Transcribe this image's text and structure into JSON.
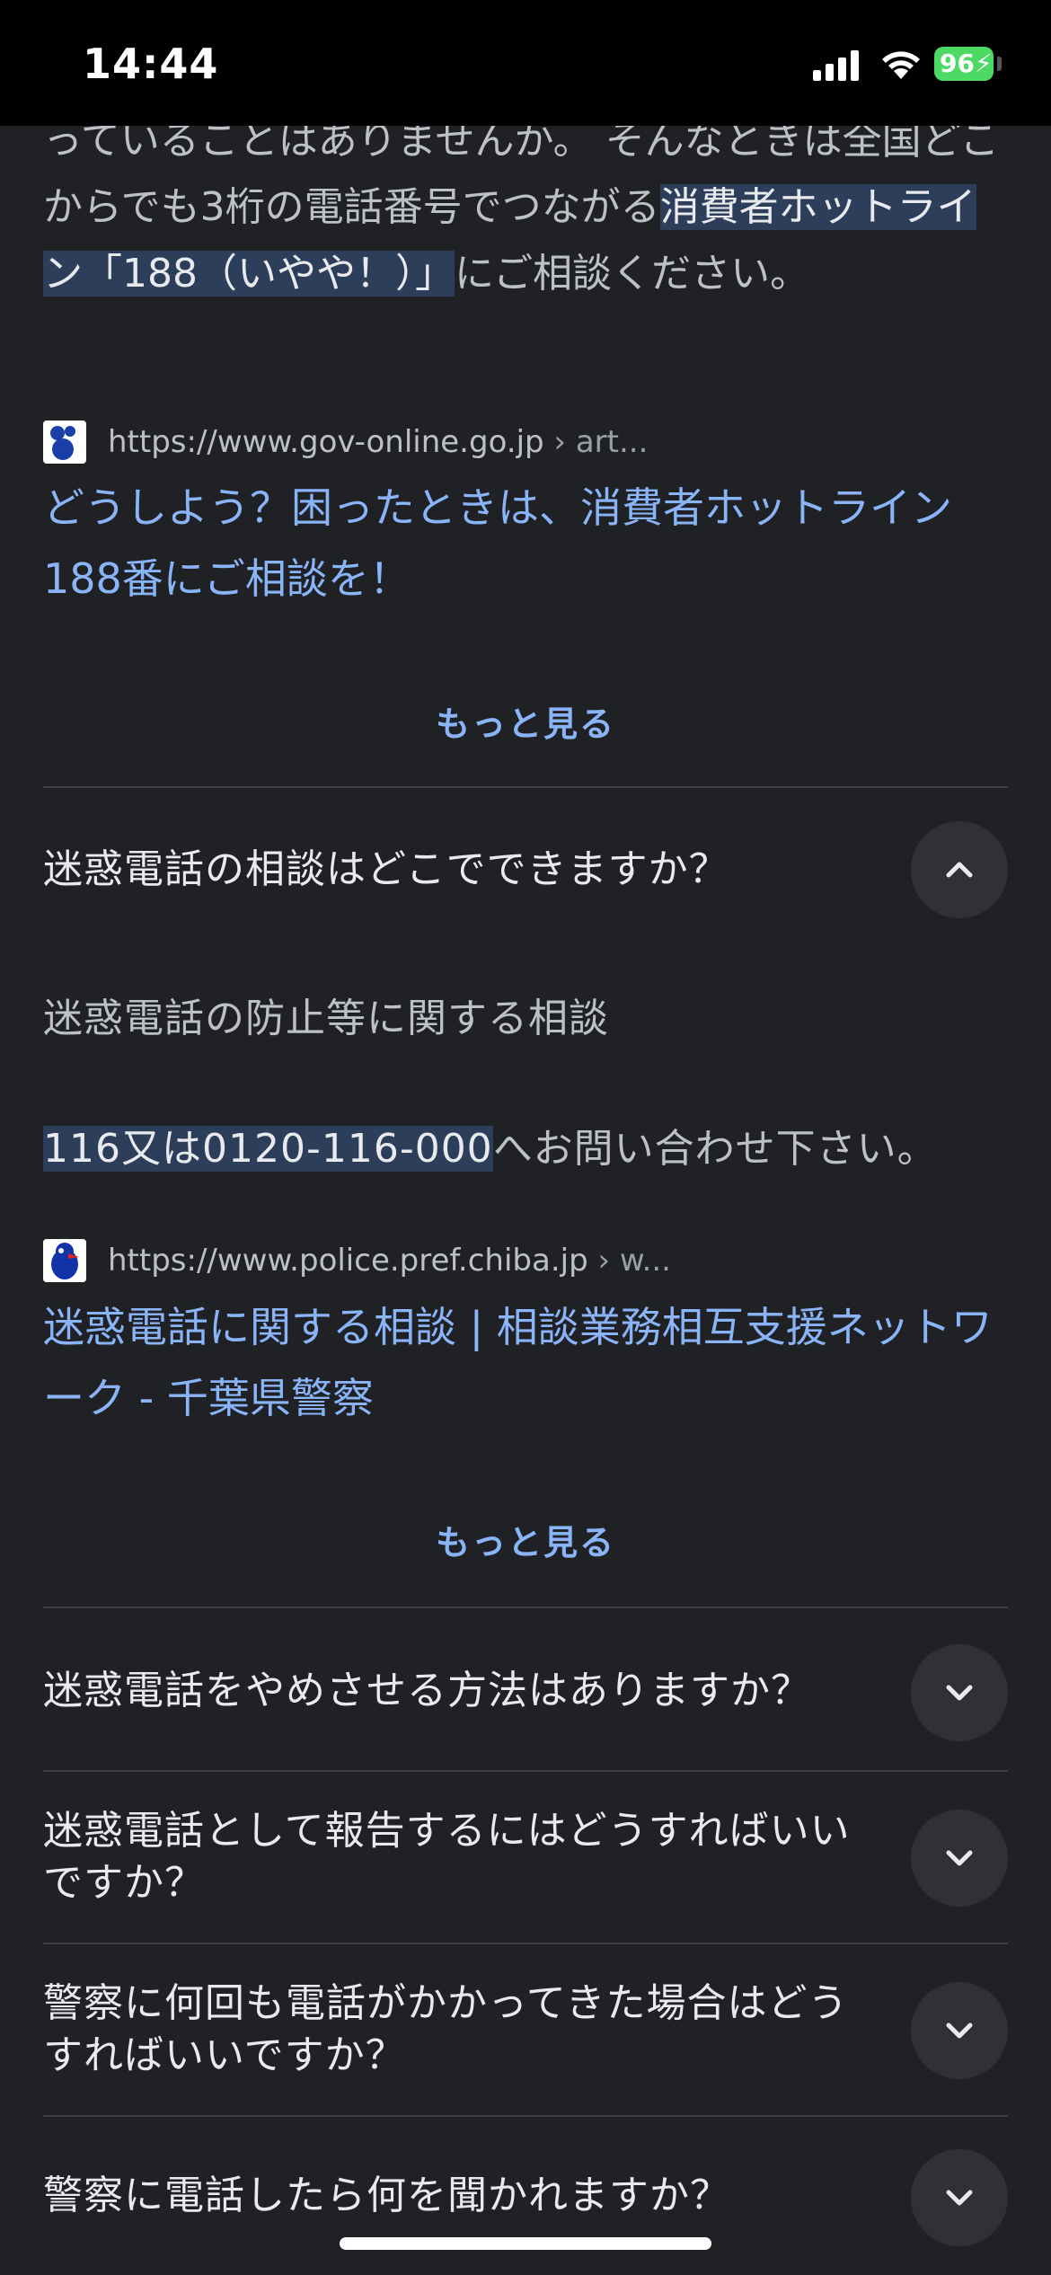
{
  "status_bar": {
    "time": "14:44",
    "battery": "96"
  },
  "snippet1": {
    "pre": "っていることはありませんか。 そんなときは全国どこからでも3桁の電話番号でつながる",
    "highlight": "消費者ホットライン「188（いやや！）」",
    "post": "にご相談ください。"
  },
  "result1": {
    "url": "https://www.gov-online.go.jp",
    "crumb": " › art...",
    "title": "どうしよう？困ったときは、消費者ホットライン188番にご相談を！",
    "more": "もっと見る"
  },
  "faq": [
    {
      "question": "迷惑電話の相談はどこでできますか？",
      "expanded": true
    },
    {
      "question": "迷惑電話をやめさせる方法はありますか？",
      "expanded": false
    },
    {
      "question": "迷惑電話として報告するにはどうすればいいですか？",
      "expanded": false
    },
    {
      "question": "警察に何回も電話がかかってきた場合はどうすればいいですか？",
      "expanded": false
    },
    {
      "question": "警察に電話したら何を聞かれますか？",
      "expanded": false
    }
  ],
  "answer1": {
    "line1": "迷惑電話の防止等に関する相談",
    "highlight": "116又は0120-116-000",
    "post": "へお問い合わせ下さい。"
  },
  "result2": {
    "url": "https://www.police.pref.chiba.jp",
    "crumb": " › w...",
    "title": "迷惑電話に関する相談 | 相談業務相互支援ネットワーク - 千葉県警察",
    "more": "もっと見る"
  },
  "icons": {
    "collapse": "chevron-up-icon",
    "expand": "chevron-down-icon"
  },
  "colors": {
    "background": "#202124",
    "link": "#8ab4f8",
    "highlight": "#2d3e5b",
    "button_bg": "#303134"
  }
}
